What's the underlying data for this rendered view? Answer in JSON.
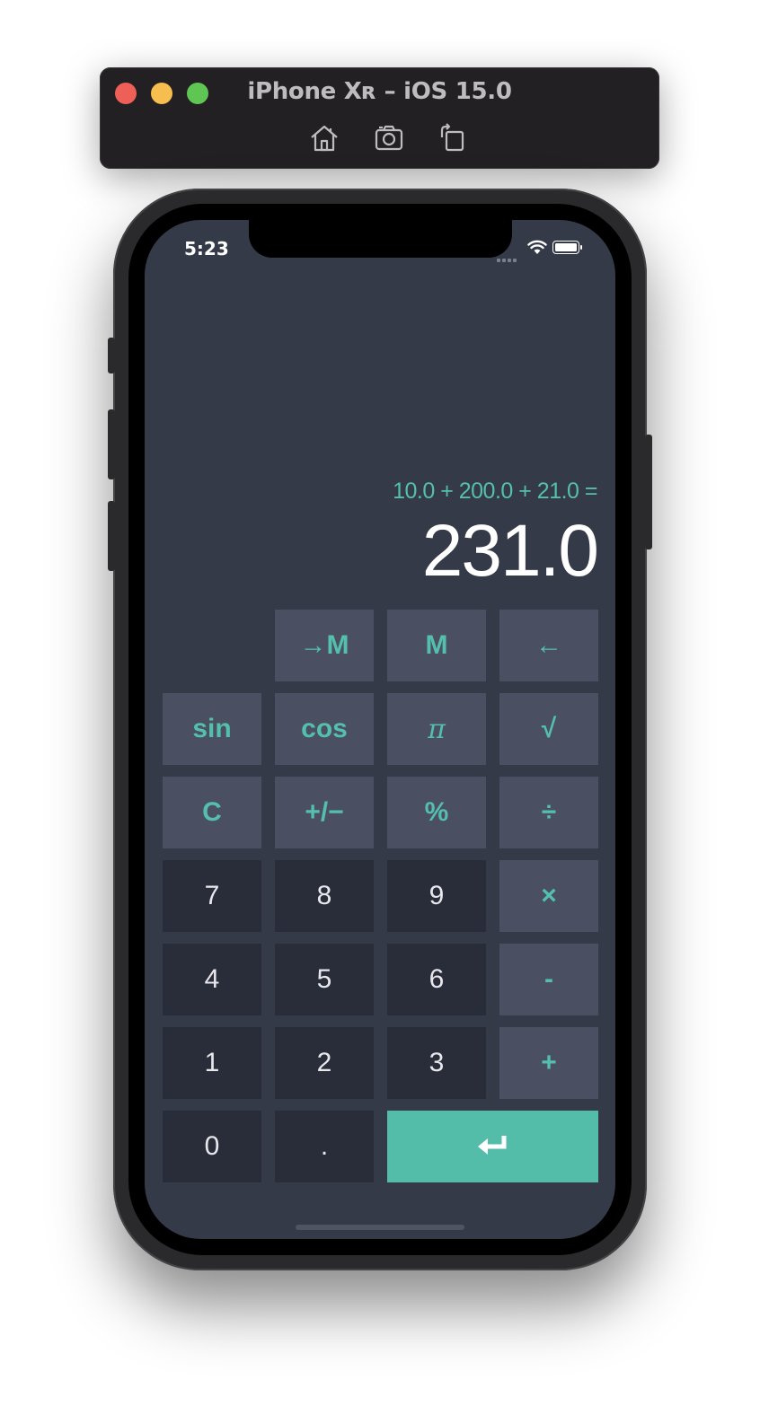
{
  "simulator": {
    "title": "iPhone Xʀ – iOS 15.0",
    "toolbar_icons": [
      "home-icon",
      "screenshot-icon",
      "rotate-icon"
    ]
  },
  "status_bar": {
    "time": "5:23",
    "icons": [
      "cellular-signal-icon",
      "wifi-icon",
      "battery-icon"
    ]
  },
  "display": {
    "expression": "10.0 + 200.0 + 21.0 =",
    "result": "231.0"
  },
  "keys": {
    "to_memory": "→M",
    "memory": "M",
    "backspace": "←",
    "sin": "sin",
    "cos": "cos",
    "pi": "π",
    "sqrt": "√",
    "clear": "C",
    "sign": "+/−",
    "percent": "%",
    "divide": "÷",
    "seven": "7",
    "eight": "8",
    "nine": "9",
    "multiply": "×",
    "four": "4",
    "five": "5",
    "six": "6",
    "minus": "-",
    "one": "1",
    "two": "2",
    "three": "3",
    "plus": "+",
    "zero": "0",
    "decimal": ".",
    "enter_icon": "return-arrow-icon"
  },
  "colors": {
    "screen_bg": "#353a48",
    "function_key": "#4a4f62",
    "number_key": "#292d3a",
    "accent": "#55bfae",
    "enter_key": "#53bdaa"
  }
}
